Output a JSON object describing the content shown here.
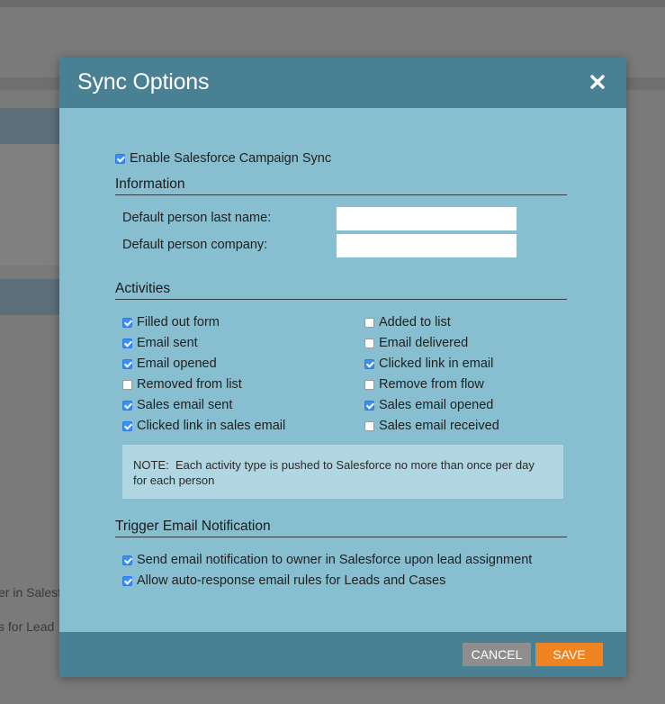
{
  "background": {
    "text_line_1": "er in Salesf",
    "text_line_2": "s for Lead"
  },
  "modal": {
    "title": "Sync Options",
    "close_icon": "close-icon",
    "enable_sync": {
      "label": "Enable Salesforce Campaign Sync",
      "checked": true
    },
    "information": {
      "heading": "Information",
      "fields": [
        {
          "label": "Default person last name:",
          "value": ""
        },
        {
          "label": "Default person company:",
          "value": ""
        }
      ]
    },
    "activities": {
      "heading": "Activities",
      "left": [
        {
          "label": "Filled out form",
          "checked": true
        },
        {
          "label": "Email sent",
          "checked": true
        },
        {
          "label": "Email opened",
          "checked": true
        },
        {
          "label": "Removed from list",
          "checked": false
        },
        {
          "label": "Sales email sent",
          "checked": true
        },
        {
          "label": "Clicked link in sales email",
          "checked": true
        }
      ],
      "right": [
        {
          "label": "Added to list",
          "checked": false
        },
        {
          "label": "Email delivered",
          "checked": false
        },
        {
          "label": "Clicked link in email",
          "checked": true
        },
        {
          "label": "Remove from flow",
          "checked": false
        },
        {
          "label": "Sales email opened",
          "checked": true
        },
        {
          "label": "Sales email received",
          "checked": false
        }
      ],
      "note_line_1": "NOTE:  Each activity type is pushed to Salesforce no more than once per day",
      "note_line_2": "for each person"
    },
    "trigger": {
      "heading": "Trigger Email Notification",
      "items": [
        {
          "label": "Send email notification to owner in Salesforce upon lead assignment",
          "checked": true
        },
        {
          "label": "Allow auto-response email rules for Leads and Cases",
          "checked": true
        }
      ]
    },
    "footer": {
      "cancel_label": "CANCEL",
      "save_label": "SAVE"
    }
  },
  "colors": {
    "header": "#4a8094",
    "body": "#87bfd1",
    "save": "#f08321",
    "cancel": "#8e8e8e",
    "checkbox_checked": "#3d8ef2"
  }
}
